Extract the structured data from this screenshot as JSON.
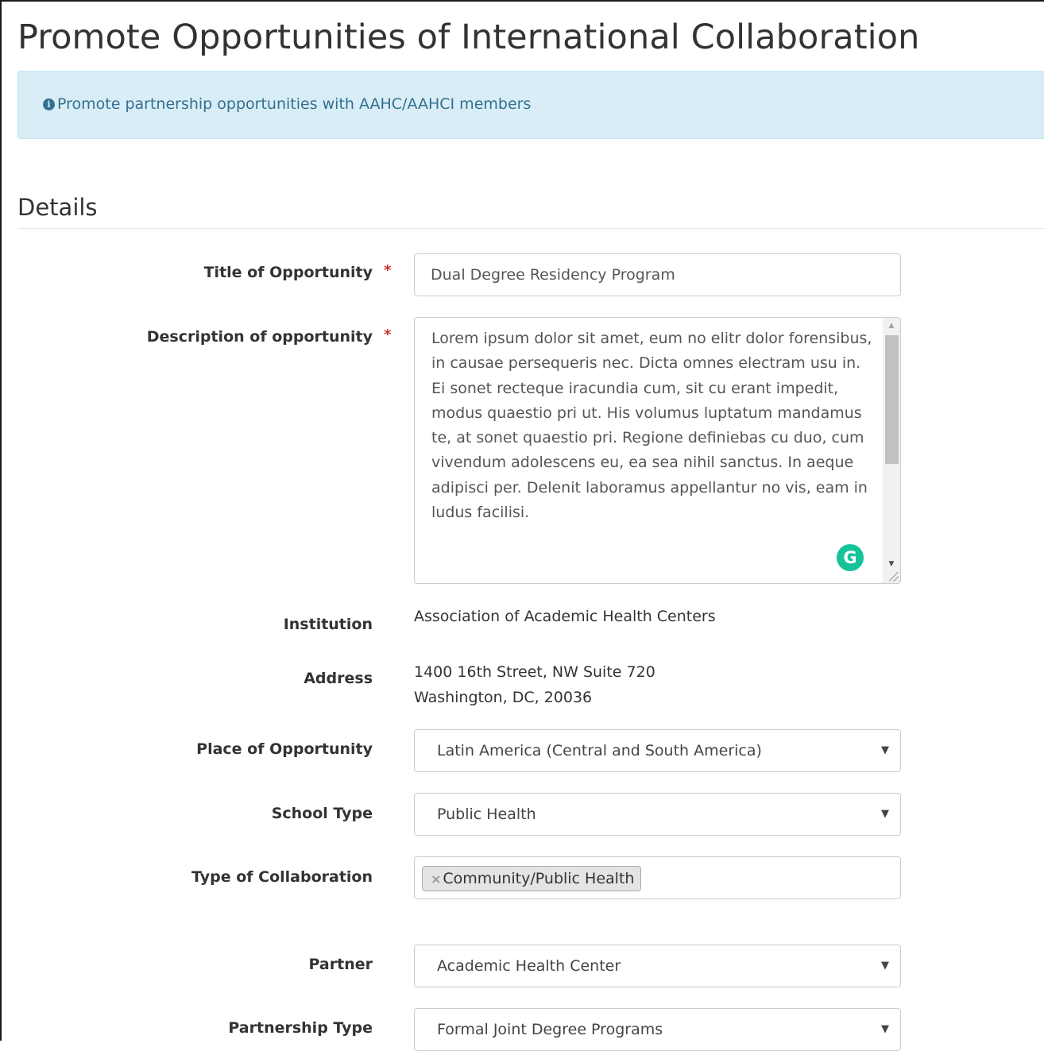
{
  "page": {
    "title": "Promote Opportunities of International Collaboration"
  },
  "alert": {
    "icon": "info-circle-icon",
    "text": "Promote partnership opportunities with AAHC/AAHCI members"
  },
  "section": {
    "heading": "Details"
  },
  "form": {
    "title_label": "Title of Opportunity",
    "title_value": "Dual Degree Residency Program",
    "description_label": "Description of opportunity",
    "description_value": "Lorem ipsum dolor sit amet, eum no elitr dolor forensibus, in causae persequeris nec. Dicta omnes electram usu in. Ei sonet recteque iracundia cum, sit cu erant impedit, modus quaestio pri ut. His volumus luptatum mandamus te, at sonet quaestio pri. Regione definiebas cu duo, cum vivendum adolescens eu, ea sea nihil sanctus. In aeque adipisci per. Delenit laboramus appellantur no vis, eam in ludus facilisi.",
    "required_mark": "*",
    "institution_label": "Institution",
    "institution_value": "Association of Academic Health Centers",
    "address_label": "Address",
    "address_line1": "1400 16th Street, NW Suite 720",
    "address_line2": "Washington, DC, 20036",
    "place_label": "Place of Opportunity",
    "place_value": "Latin America (Central and South America)",
    "school_type_label": "School Type",
    "school_type_value": "Public Health",
    "collab_label": "Type of Collaboration",
    "collab_tag_remove": "×",
    "collab_tag": "Community/Public Health",
    "partner_label": "Partner",
    "partner_value": "Academic Health Center",
    "partnership_type_label": "Partnership Type",
    "partnership_type_value": "Formal Joint Degree Programs"
  },
  "widgets": {
    "grammarly_glyph": "G",
    "caret_glyph": "▼",
    "scroll_up_glyph": "▲",
    "scroll_down_glyph": "▼"
  },
  "colors": {
    "alert_bg": "#d9edf7",
    "alert_text": "#31708f",
    "required": "#c9302c",
    "grammarly": "#15c39a"
  }
}
